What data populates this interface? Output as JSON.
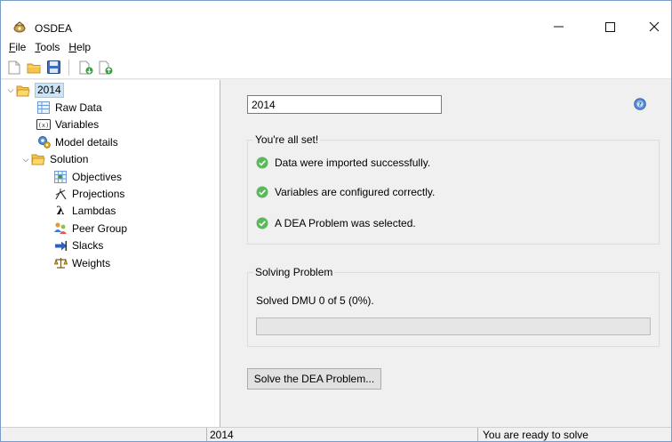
{
  "window": {
    "title": "OSDEA",
    "controls": {
      "minimize": "—",
      "maximize": "☐",
      "close": "✕"
    }
  },
  "menu": {
    "items": [
      {
        "label": "File"
      },
      {
        "label": "Tools"
      },
      {
        "label": "Help"
      }
    ]
  },
  "toolbar": {
    "icons": [
      "new-document-icon",
      "open-folder-icon",
      "save-floppy-icon",
      "import-green-arrow-icon",
      "export-green-arrow-icon"
    ]
  },
  "tree": {
    "root": {
      "label": "2014",
      "expanded": true
    },
    "items": [
      {
        "label": "Raw Data",
        "icon": "raw-data-icon"
      },
      {
        "label": "Variables",
        "icon": "variables-icon"
      },
      {
        "label": "Model details",
        "icon": "model-details-icon"
      }
    ],
    "solution": {
      "label": "Solution",
      "expanded": true,
      "children": [
        {
          "label": "Objectives",
          "icon": "objectives-icon"
        },
        {
          "label": "Projections",
          "icon": "projections-icon"
        },
        {
          "label": "Lambdas",
          "icon": "lambda-icon"
        },
        {
          "label": "Peer Group",
          "icon": "peer-group-icon"
        },
        {
          "label": "Slacks",
          "icon": "slacks-icon"
        },
        {
          "label": "Weights",
          "icon": "weights-icon"
        }
      ]
    }
  },
  "content": {
    "problem_name": "2014",
    "ready_group": {
      "title": "You're all set!",
      "lines": [
        "Data were imported successfully.",
        "Variables are configured correctly.",
        "A DEA Problem was selected."
      ]
    },
    "solving_group": {
      "title": "Solving Problem",
      "progress_text": "Solved DMU 0 of 5 (0%).",
      "progress_fraction": 0
    },
    "solve_button": "Solve the DEA Problem..."
  },
  "statusbar": {
    "left": "",
    "middle": "2014",
    "right": "You are ready to solve"
  },
  "colors": {
    "selection": "#cce4f7",
    "ok_green": "#5cb85c",
    "folder_yellow": "#f4c54a",
    "progress_green": "#06b025"
  }
}
